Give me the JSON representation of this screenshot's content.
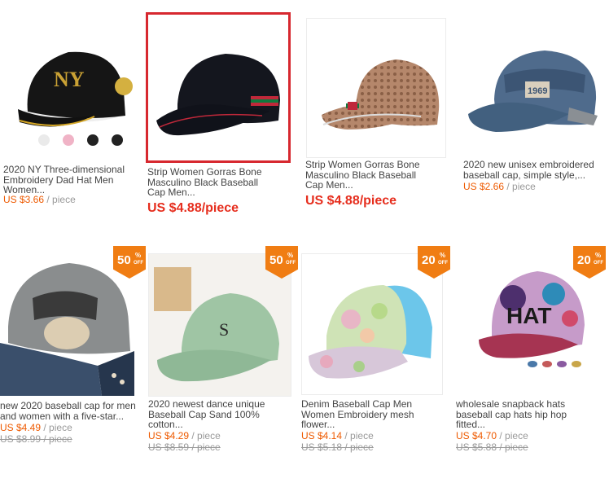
{
  "products": [
    {
      "title": "2020 NY Three-dimensional\nEmbroidery Dad Hat Men\nWomen...",
      "price": "US $3.66",
      "unit": " / piece",
      "image": "black-ny-baseball-cap-with-color-swatches"
    },
    {
      "title": "Strip Women Gorras Bone\nMasculino Black Baseball\nCap Men...",
      "big_price": "US $4.88/piece",
      "image": "black-baseball-cap-red-green-stripe",
      "selected": true
    },
    {
      "title": "Strip Women Gorras Bone\nMasculino Black Baseball\nCap Men...",
      "big_price": "US $4.88/piece",
      "image": "brown-monogram-baseball-cap"
    },
    {
      "title": "2020 new unisex embroidered\nbaseball cap, simple style,...",
      "price": "US $2.66",
      "unit": " / piece",
      "image": "distressed-denim-1969-cap"
    },
    {
      "title": "new 2020 baseball cap for men\nand women with a five-star...",
      "price": "US $4.49",
      "unit": " / piece",
      "old_price": "US $8.99 / piece",
      "badge": "50",
      "image": "grey-denim-fist-cap"
    },
    {
      "title": "2020 newest dance unique\nBaseball Cap Sand 100%\ncotton...",
      "price": "US $4.29",
      "unit": " / piece",
      "old_price": "US $8.59 / piece",
      "badge": "50",
      "image": "mint-green-baseball-cap"
    },
    {
      "title": "Denim Baseball Cap Men\nWomen Embroidery mesh\nflower...",
      "price": "US $4.14",
      "unit": " / piece",
      "old_price": "US $5.18 / piece",
      "badge": "20",
      "image": "floral-mesh-trucker-cap"
    },
    {
      "title": "wholesale snapback hats\nbaseball cap hats hip hop\nfitted...",
      "price": "US $4.70",
      "unit": " / piece",
      "old_price": "US $5.88 / piece",
      "badge": "20",
      "image": "graffiti-hat-snapback-cap"
    }
  ],
  "badge_text": {
    "pct": "%",
    "off": "OFF"
  },
  "img_text": {
    "cap4_patch": "1969",
    "cap8_front": "HAT"
  },
  "colors": {
    "price": "#ee5a00",
    "selected_price": "#e62e1e",
    "badge": "#f07d13",
    "selection": "#d7282f"
  }
}
